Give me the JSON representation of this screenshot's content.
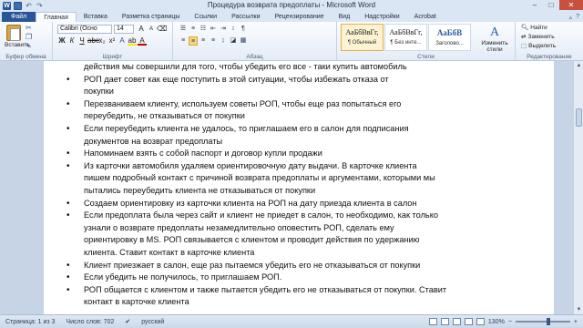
{
  "window": {
    "title": "Процедура возврата предоплаты - Microsoft Word",
    "app_icon": "W",
    "controls": {
      "minimize": "–",
      "maximize": "□",
      "close": "✕"
    }
  },
  "tabs": [
    {
      "label": "Файл",
      "kind": "file"
    },
    {
      "label": "Главная",
      "kind": "active"
    },
    {
      "label": "Вставка",
      "kind": ""
    },
    {
      "label": "Разметка страницы",
      "kind": ""
    },
    {
      "label": "Ссылки",
      "kind": ""
    },
    {
      "label": "Рассылки",
      "kind": ""
    },
    {
      "label": "Рецензирование",
      "kind": ""
    },
    {
      "label": "Вид",
      "kind": ""
    },
    {
      "label": "Надстройки",
      "kind": ""
    },
    {
      "label": "Acrobat",
      "kind": ""
    }
  ],
  "ribbon": {
    "clipboard": {
      "paste_label": "Вставить",
      "group_label": "Буфер обмена"
    },
    "font": {
      "name": "Calibri (Осно",
      "size": "14",
      "group_label": "Шрифт"
    },
    "paragraph": {
      "group_label": "Абзац"
    },
    "styles": {
      "group_label": "Стили",
      "items": [
        {
          "sample": "АаБбВвГг,",
          "name": "¶ Обычный",
          "selected": true,
          "heading": false
        },
        {
          "sample": "АаБбВвГг,",
          "name": "¶ Без инте...",
          "selected": false,
          "heading": false
        },
        {
          "sample": "АаБбВ",
          "name": "Заголово...",
          "selected": false,
          "heading": true
        }
      ],
      "change_label": "Изменить стили"
    },
    "editing": {
      "group_label": "Редактирование",
      "find": "Найти",
      "replace": "Заменить",
      "select": "Выделить"
    }
  },
  "document": {
    "lines": [
      {
        "text": "действия мы совершили для того, чтобы убедить его все - таки купить автомобиль",
        "bullet": false
      },
      {
        "text": "РОП дает совет как еще поступить в этой ситуации, чтобы избежать отказа от",
        "bullet": true
      },
      {
        "text": "покупки",
        "bullet": false
      },
      {
        "text": "Перезваниваем клиенту, используем советы РОП, чтобы еще раз попытаться его",
        "bullet": true
      },
      {
        "text": "переубедить, не отказываться от покупки",
        "bullet": false
      },
      {
        "text": "Если переубедить клиента не удалось, то приглашаем его в салон для подписания",
        "bullet": true
      },
      {
        "text": "документов на возврат предоплаты",
        "bullet": false
      },
      {
        "text": "Напоминаем взять с собой паспорт и договор купли продажи",
        "bullet": true
      },
      {
        "text": "Из карточки автомобиля удаляем ориентировочную дату выдачи. В карточке клиента",
        "bullet": true
      },
      {
        "text": "пишем подробный контакт с причиной возврата предоплаты и аргументами, которыми мы",
        "bullet": false
      },
      {
        "text": "пытались переубедить клиента не отказываться от покупки",
        "bullet": false
      },
      {
        "text": "Создаем ориентировку из карточки клиента на РОП на дату приезда клиента в салон",
        "bullet": true
      },
      {
        "text": "Если предоплата была через сайт и клиент не приедет в салон, то необходимо, как только",
        "bullet": true
      },
      {
        "text": "узнали о возврате предоплаты незамедлительно оповестить РОП, сделать ему",
        "bullet": false
      },
      {
        "text": "ориентировку в MS. РОП связывается с клиентом и проводит действия по удержанию",
        "bullet": false
      },
      {
        "text": "клиента. Ставит контакт в карточке клиента",
        "bullet": false
      },
      {
        "text": "Клиент приезжает в салон, еще раз пытаемся убедить его не отказываться от покупки",
        "bullet": true
      },
      {
        "text": "Если убедить не получилось, то приглашаем РОП.",
        "bullet": true
      },
      {
        "text": "РОП общается с клиентом и также пытается убедить его не отказываться от покупки. Ставит",
        "bullet": true
      },
      {
        "text": "контакт в карточке клиента",
        "bullet": false
      }
    ]
  },
  "status": {
    "page": "Страница: 1 из 3",
    "words": "Число слов: 702",
    "language": "русский",
    "zoom": "130%",
    "zoom_level": 0.6
  }
}
